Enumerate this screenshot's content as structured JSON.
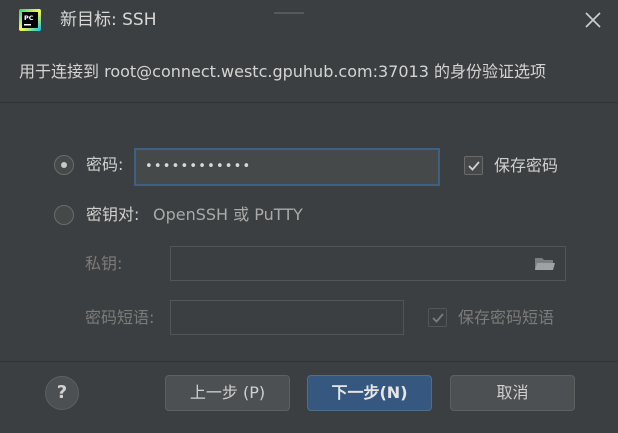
{
  "window": {
    "title": "新目标: SSH",
    "app_icon": "pycharm-icon",
    "app_icon_text": "PC"
  },
  "header": {
    "description": "用于连接到 root@connect.westc.gpuhub.com:37013 的身份验证选项"
  },
  "auth": {
    "password_option": {
      "label": "密码:",
      "selected": true,
      "value_masked": "••••••••••••",
      "save_label": "保存密码",
      "save_checked": true
    },
    "key_pair_option": {
      "label": "密钥对:",
      "hint": "OpenSSH 或 PuTTY",
      "selected": false,
      "private_key_label": "私钥:",
      "private_key_value": "",
      "passphrase_label": "密码短语:",
      "passphrase_value": "",
      "save_passphrase_label": "保存密码短语",
      "save_passphrase_checked": true
    }
  },
  "footer": {
    "help_label": "?",
    "back_label": "上一步 (P)",
    "next_label": "下一步(N)",
    "cancel_label": "取消"
  },
  "colors": {
    "background": "#3c3f41",
    "input_background": "#45494a",
    "focus_border": "#3d6185",
    "primary_button": "#365880"
  }
}
